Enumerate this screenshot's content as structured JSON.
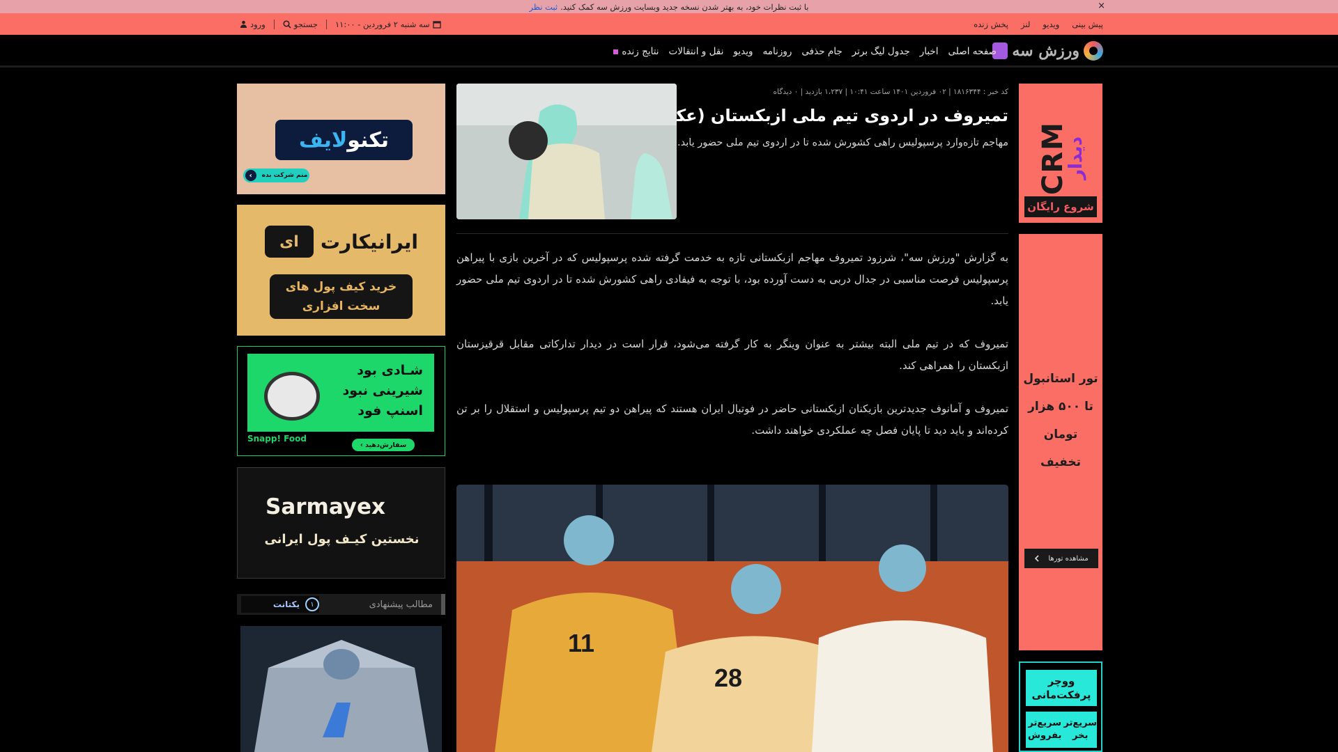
{
  "notice": {
    "text": "با ثبت نظرات خود، به بهتر شدن نسخه جدید وبسایت ورزش سه کمک کنید.",
    "link": "ثبت نظر",
    "close": "×"
  },
  "util": {
    "links": [
      "پیش بینی",
      "ویدیو",
      "لنز",
      "پخش زنده"
    ],
    "date": "سه شنبه ۲ فروردین - ۱۱:۰۰",
    "search": "جستجو",
    "login": "ورود"
  },
  "nav": {
    "logo_text": "ورزش سه",
    "items": [
      "صفحه اصلی",
      "اخبار",
      "جدول لیگ برتر",
      "جام حذفی",
      "روزنامه",
      "ویدیو",
      "نقل و انتقالات",
      "نتایج زنده"
    ]
  },
  "article": {
    "meta": "کد خبر : ۱۸۱۶۳۴۴ | ۰۲ فروردین ۱۴۰۱ ساعت ۱۰:۴۱ | ۱،۲۳۷ بازدید | ۰ دیدگاه",
    "title": "تمیروف در اردوی تیم ملی ازبکستان (عکس)",
    "lead": "مهاجم تازه‌وارد پرسپولیس راهی کشورش شده تا در اردوی تیم ملی حضور یابد.",
    "paragraphs": [
      "به گزارش \"ورزش سه\"، شرزود تمیروف مهاجم ازبکستانی تازه به خدمت گرفته شده پرسپولیس که در آخرین بازی با پیراهن پرسپولیس فرصت مناسبی در جدال دربی به دست آورده بود، با توجه به فیفادی راهی کشورش شده تا در اردوی تیم ملی حضور یابد.",
      "تمیروف که در تیم ملی البته بیشتر به عنوان وینگر به کار گرفته می‌شود، قرار است در دیدار تدارکاتی مقابل قرقیزستان ازبکستان را همراهی کند.",
      "تمیروف و آمانوف جدیدترین بازیکنان ازبکستانی حاضر در فوتبال ایران هستند که پیراهن دو تیم پرسپولیس و استقلال را بر تن کرده‌اند و باید دید تا پایان فصل چه عملکردی خواهند داشت."
    ]
  },
  "ads": {
    "crm": {
      "big": "CRM",
      "small": "دیدار",
      "button": "شروع رایگان"
    },
    "tour": {
      "line1": "تور استانبول",
      "line2": "تا ۵۰۰ هزار تومان",
      "line3": "تخفیف",
      "button": "مشاهده تورها"
    },
    "voucher": {
      "top": "ووچر پرفکت‌مانی",
      "buy": "سریع‌تر بخر",
      "sell": "سریع‌تر بفروش"
    },
    "technolife": {
      "name1": "تکنو",
      "name2": "لایف",
      "pill": "منم شرکت بده"
    },
    "iranicard": {
      "name": "ایرانیکارت",
      "glyph": "ای",
      "line1": "خرید کیف پول های",
      "line2": "سخت افزاری"
    },
    "snappfood": {
      "line1": "شـادی بود",
      "line2": "شیرینی نبود",
      "line3": "اسنپ فود",
      "brand": "Snapp! Food",
      "order": "سفارش‌دهید ›"
    },
    "sarmayex": {
      "word": "Sarmayex",
      "sub": "نخستین کیـف پول ایرانی"
    }
  },
  "suggested": {
    "label": "مطالب پیشنهادی",
    "partner": "یکتانت",
    "partner_num": "۱"
  },
  "colors": {
    "accent": "#fb6e65",
    "notice": "#e6a2a8",
    "background": "#000000"
  }
}
